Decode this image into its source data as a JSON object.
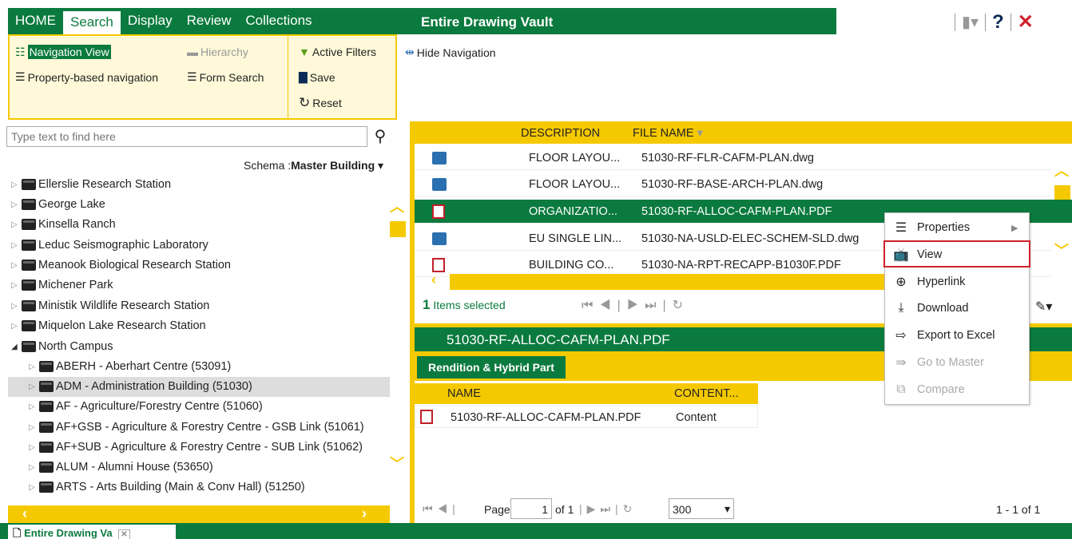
{
  "header": {
    "tabs": [
      "HOME",
      "Search",
      "Display",
      "Review",
      "Collections"
    ],
    "active_tab": "Search",
    "title": "Entire Drawing Vault"
  },
  "ribbon": {
    "navigation_view": "Navigation View",
    "hierarchy": "Hierarchy",
    "active_filters": "Active Filters",
    "hide_navigation": "Hide Navigation",
    "property_nav": "Property-based navigation",
    "form_search": "Form Search",
    "save": "Save",
    "reset": "Reset"
  },
  "search": {
    "placeholder": "Type text to find here"
  },
  "schema": {
    "label": "Schema :",
    "value": "Master Building"
  },
  "tree": [
    "Ellerslie Research Station",
    "George Lake",
    "Kinsella Ranch",
    "Leduc Seismographic Laboratory",
    "Meanook Biological Research Station",
    "Michener Park",
    "Ministik Wildlife Research Station",
    "Miquelon Lake Research Station",
    "North Campus",
    "ABERH - Aberhart Centre (53091)",
    "ADM - Administration Building (51030)",
    "AF - Agriculture/Forestry Centre (51060)",
    "AF+GSB - Agriculture & Forestry Centre - GSB Link (51061)",
    "AF+SUB - Agriculture & Forestry Centre - SUB Link (51062)",
    "ALUM - Alumni House (53650)",
    "ARTS - Arts Building (Main & Conv Hall) (51250)"
  ],
  "grid": {
    "col_desc": "DESCRIPTION",
    "col_file": "FILE NAME",
    "rows": [
      {
        "desc": "FLOOR LAYOU...",
        "file": "51030-RF-FLR-CAFM-PLAN.dwg",
        "type": "dwg"
      },
      {
        "desc": "FLOOR LAYOU...",
        "file": "51030-RF-BASE-ARCH-PLAN.dwg",
        "type": "dwg"
      },
      {
        "desc": "ORGANIZATIO...",
        "file": "51030-RF-ALLOC-CAFM-PLAN.PDF",
        "type": "pdf"
      },
      {
        "desc": "EU SINGLE LIN...",
        "file": "51030-NA-USLD-ELEC-SCHEM-SLD.dwg",
        "type": "dwg"
      },
      {
        "desc": "BUILDING CO...",
        "file": "51030-NA-RPT-RECAPP-B1030F.PDF",
        "type": "pdf"
      }
    ]
  },
  "selection": {
    "count": "1",
    "text": "Items selected"
  },
  "preview": {
    "title": "51030-RF-ALLOC-CAFM-PLAN.PDF",
    "tab": "Rendition & Hybrid Part",
    "col_name": "NAME",
    "col_content": "CONTENT...",
    "row_name": "51030-RF-ALLOC-CAFM-PLAN.PDF",
    "row_content": "Content"
  },
  "pager": {
    "page_label": "Page",
    "page": "1",
    "of": "of 1",
    "size": "300",
    "range": "1 - 1 of 1"
  },
  "context_menu": [
    "Properties",
    "View",
    "Hyperlink",
    "Download",
    "Export to Excel",
    "Go to Master",
    "Compare"
  ],
  "bottom_tab": "Entire Drawing Va"
}
